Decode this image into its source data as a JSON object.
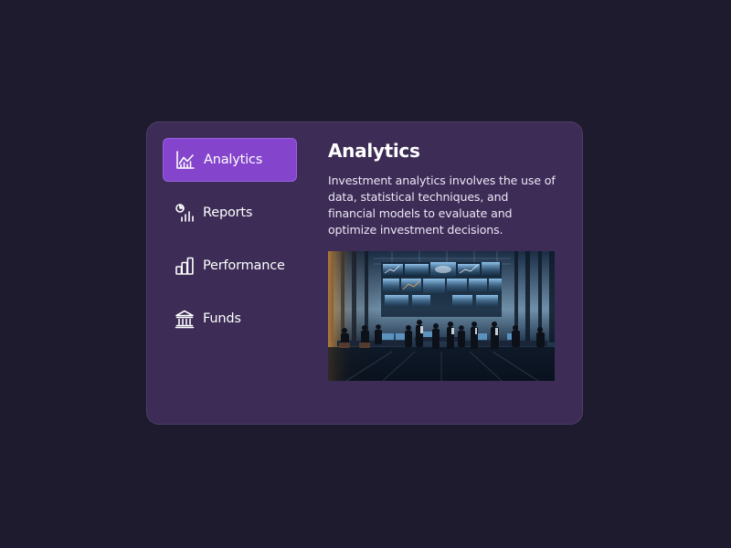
{
  "nav": {
    "items": [
      {
        "label": "Analytics",
        "icon": "chart-line-icon",
        "active": true
      },
      {
        "label": "Reports",
        "icon": "report-chart-icon",
        "active": false
      },
      {
        "label": "Performance",
        "icon": "bar-chart-icon",
        "active": false
      },
      {
        "label": "Funds",
        "icon": "bank-icon",
        "active": false
      }
    ]
  },
  "content": {
    "title": "Analytics",
    "description": "Investment analytics involves the use of data, statistical techniques, and financial models to evaluate and optimize investment decisions.",
    "image": "office-team-analytics-photo"
  },
  "colors": {
    "page_background": "#1f1b2e",
    "card_background": "#3c2c56",
    "accent": "#8445cc"
  }
}
